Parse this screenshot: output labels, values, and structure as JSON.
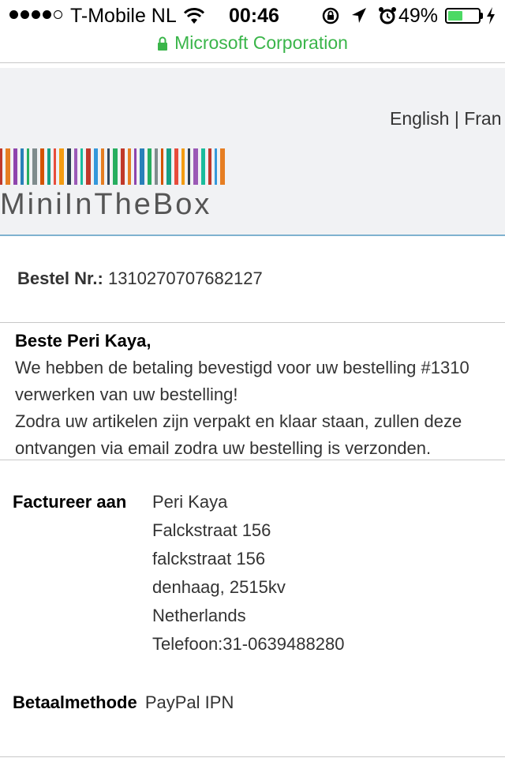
{
  "status_bar": {
    "carrier": "T-Mobile NL",
    "time": "00:46",
    "battery": "49%",
    "battery_level": 0.49,
    "battery_color": "#4cd964"
  },
  "url_bar": {
    "site_label": "Microsoft Corporation",
    "color": "#3ab54a"
  },
  "header": {
    "language_links": "English | Fran",
    "logo_text": "MiniInTheBox"
  },
  "order": {
    "label": "Bestel Nr.:",
    "number": "1310270707682127"
  },
  "message": {
    "greeting": "Beste Peri Kaya,",
    "lines": [
      "We hebben de betaling bevestigd voor uw bestelling #1310",
      "verwerken van uw bestelling!",
      "Zodra uw artikelen zijn verpakt en klaar staan, zullen deze",
      "ontvangen via email zodra uw bestelling is verzonden."
    ]
  },
  "billing": {
    "label": "Factureer aan",
    "lines": [
      "Peri Kaya",
      "Falckstraat 156",
      "falckstraat 156",
      "denhaag, 2515kv",
      "Netherlands",
      "Telefoon:31-0639488280"
    ]
  },
  "payment": {
    "label": "Betaalmethode",
    "value": "PayPal IPN"
  }
}
